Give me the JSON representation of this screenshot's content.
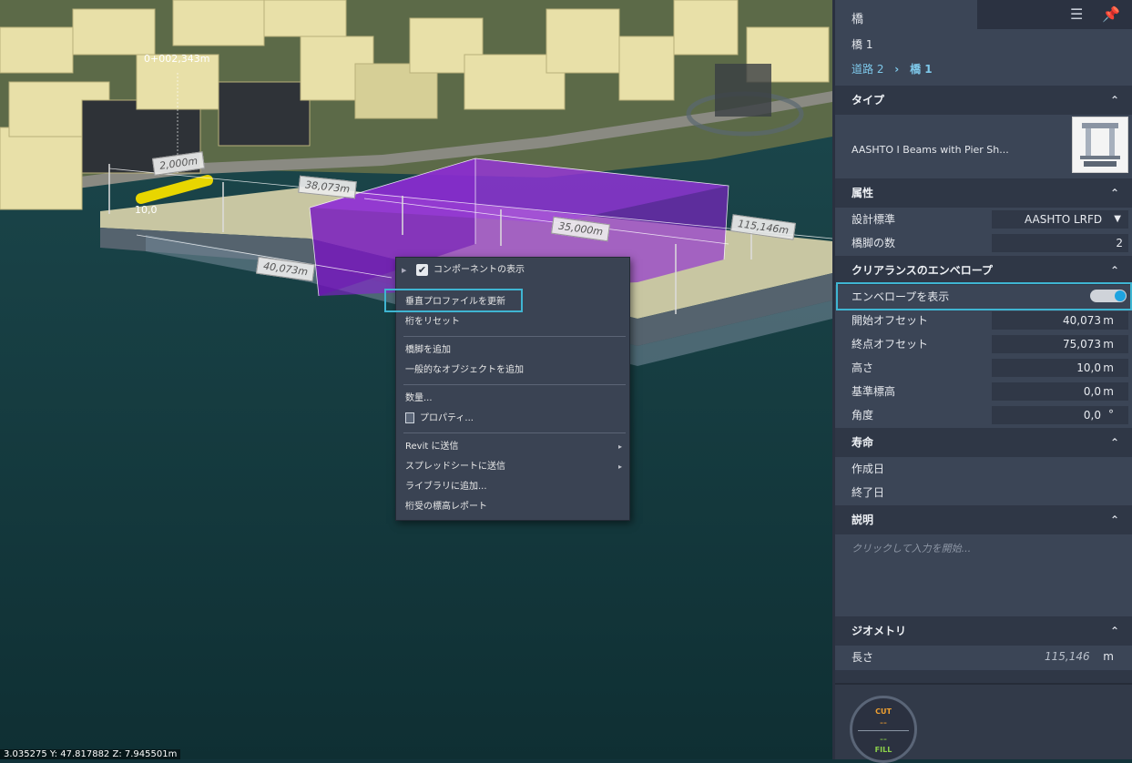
{
  "viewport": {
    "dimensions": {
      "top_offset": "0+002,343m",
      "d2000": "2,000m",
      "d38073": "38,073m",
      "d35000": "35,000m",
      "d115146": "115,146m",
      "d40073": "40,073m",
      "d10": "10,0"
    },
    "coords": "3.035275 Y: 47.817882 Z: 7.945501m"
  },
  "context_menu": {
    "items": [
      "コンポーネントの表示",
      "垂直プロファイルを更新",
      "桁をリセット",
      "橋脚を追加",
      "一般的なオブジェクトを追加",
      "数量...",
      "プロパティ...",
      "Revit に送信",
      "スプレッドシートに送信",
      "ライブラリに追加...",
      "桁受の標高レポート"
    ],
    "submenu_arrow": "▸",
    "checkmark": "✔",
    "expand_arrow": "▶"
  },
  "panel": {
    "tab_title": "橋",
    "object_name": "橋 1",
    "breadcrumb": {
      "parent": "道路 2",
      "separator": "›",
      "current": "橋 1"
    },
    "sections": {
      "type": {
        "title": "タイプ",
        "style_name": "AASHTO I Beams with Pier Sh..."
      },
      "properties": {
        "title": "属性",
        "design_code_label": "設計標準",
        "design_code_value": "AASHTO LRFD",
        "pier_count_label": "橋脚の数",
        "pier_count_value": "2"
      },
      "clearance": {
        "title": "クリアランスのエンベロープ",
        "show_label": "エンベロープを表示",
        "start_offset_label": "開始オフセット",
        "start_offset_value": "40,073",
        "end_offset_label": "終点オフセット",
        "end_offset_value": "75,073",
        "height_label": "高さ",
        "height_value": "10,0",
        "base_label": "基準標高",
        "base_value": "0,0",
        "angle_label": "角度",
        "angle_value": "0,0",
        "unit_m": "m",
        "unit_deg": "°"
      },
      "lifetime": {
        "title": "寿命",
        "created_label": "作成日",
        "end_label": "終了日"
      },
      "description": {
        "title": "説明",
        "placeholder": "クリックして入力を開始..."
      },
      "geometry": {
        "title": "ジオメトリ",
        "length_label": "長さ",
        "length_value": "115,146",
        "unit": "m"
      }
    },
    "gauge": {
      "cut_label": "CUT",
      "cut_value": "--",
      "fill_value": "--",
      "fill_label": "FILL"
    }
  },
  "colors": {
    "accent": "#3fb5d2",
    "envelope": "#8a1fd6",
    "toggle_on": "#1ea3e0",
    "cut": "#f0a030",
    "fill": "#8bd04a"
  }
}
